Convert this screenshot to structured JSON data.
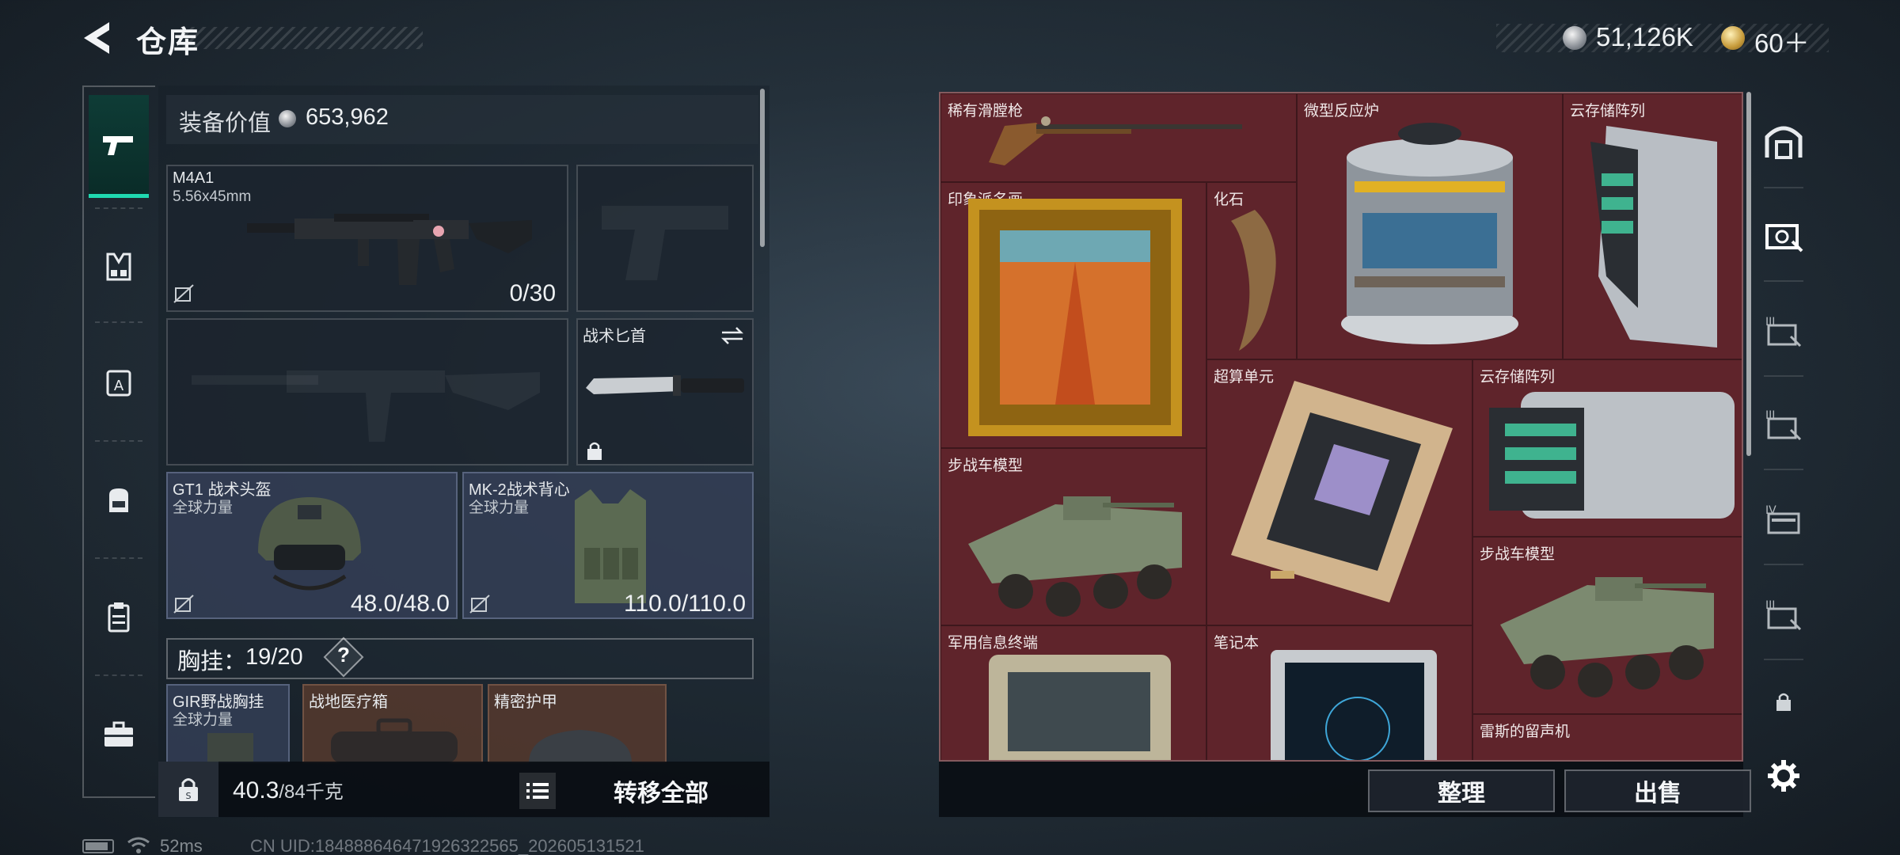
{
  "header": {
    "title": "仓库",
    "money": "51,126K",
    "tokens": "60＋",
    "back_icon": "back-arrow-icon",
    "money_icon": "silver-coin-icon",
    "token_icon": "gold-token-icon"
  },
  "sidebar": {
    "categories": [
      {
        "icon": "pistol-icon",
        "active": true
      },
      {
        "icon": "vest-icon",
        "active": false
      },
      {
        "icon": "armor-case-icon",
        "active": false
      },
      {
        "icon": "backpack-icon",
        "active": false
      },
      {
        "icon": "clipboard-icon",
        "active": false
      },
      {
        "icon": "briefcase-icon",
        "active": false
      }
    ]
  },
  "equipment": {
    "value_label": "装备价值",
    "value": "653,962",
    "primary_weapon": {
      "name": "M4A1",
      "caliber": "5.56x45mm",
      "ammo": "0/30"
    },
    "knife": {
      "name": "战术匕首"
    },
    "helmet": {
      "name": "GT1 战术头盔",
      "tag": "全球力量",
      "durability": "48.0/48.0"
    },
    "armor": {
      "name": "MK-2战术背心",
      "tag": "全球力量",
      "durability": "110.0/110.0"
    },
    "chest_rig_label": "胸挂：",
    "chest_rig_count": "19/20",
    "help": "?",
    "chest_items": [
      {
        "name": "GIR野战胸挂",
        "tag": "全球力量"
      },
      {
        "name": "战地医疗箱",
        "tag": ""
      },
      {
        "name": "精密护甲",
        "tag": ""
      }
    ],
    "weight": "40.3",
    "weight_cap": "/84千克",
    "transfer_all": "转移全部"
  },
  "storage": {
    "items": [
      {
        "name": "稀有滑膛枪"
      },
      {
        "name": "微型反应炉"
      },
      {
        "name": "云存储阵列"
      },
      {
        "name": "印象派名画"
      },
      {
        "name": "化石"
      },
      {
        "name": "超算单元"
      },
      {
        "name": "云存储阵列"
      },
      {
        "name": "步战车模型"
      },
      {
        "name": "步战车模型"
      },
      {
        "name": "军用信息终端"
      },
      {
        "name": "笔记本"
      },
      {
        "name": "雷斯的留声机"
      }
    ],
    "sort_button": "整理",
    "sell_button": "出售",
    "background_color": "#5c2329"
  },
  "storage_tabs": {
    "tabs": [
      "home-icon",
      "storage-1-icon",
      "storage-2-icon",
      "storage-3-icon",
      "storage-4-icon",
      "storage-5-icon",
      "lock-icon",
      "settings-icon"
    ],
    "labels": [
      "",
      "",
      "III",
      "III",
      "IV",
      "III",
      "",
      ""
    ]
  },
  "status": {
    "ping": "52ms",
    "uid": "CN UID:1848886464719263225​65_202605131521"
  }
}
